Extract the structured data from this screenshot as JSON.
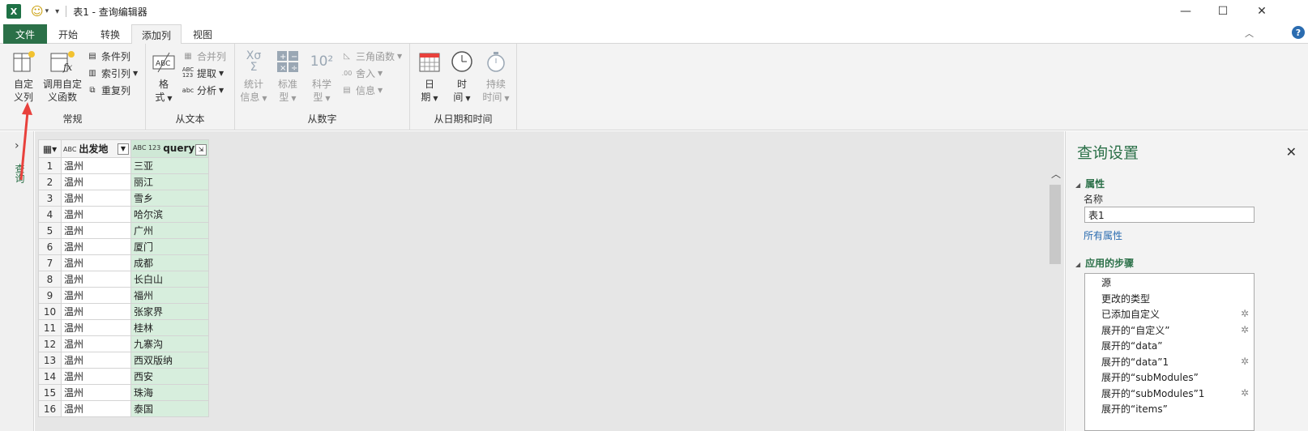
{
  "titlebar": {
    "app_icon": "X",
    "quick_access": [
      "smiley-icon",
      "dropdown-icon",
      "customize-icon"
    ],
    "title": "表1 - 查询编辑器",
    "minimize": "—",
    "maximize": "☐",
    "close": "✕"
  },
  "tabs": [
    {
      "label": "文件"
    },
    {
      "label": "开始"
    },
    {
      "label": "转换"
    },
    {
      "label": "添加列"
    },
    {
      "label": "视图"
    }
  ],
  "tabs_right": {
    "collapse": "︿",
    "help": "?"
  },
  "ribbon": {
    "groups": [
      {
        "label": "常规",
        "big_buttons": [
          {
            "line1": "自定",
            "line2": "义列"
          },
          {
            "line1": "调用自定",
            "line2": "义函数"
          }
        ],
        "small_buttons": [
          {
            "label": "条件列"
          },
          {
            "label": "索引列"
          },
          {
            "label": "重复列"
          }
        ]
      },
      {
        "label": "从文本",
        "big_buttons": [
          {
            "line1": "格",
            "line2": "式"
          }
        ],
        "small_buttons": [
          {
            "label": "合并列"
          },
          {
            "label": "提取"
          },
          {
            "label": "分析"
          }
        ]
      },
      {
        "label": "从数字",
        "big_buttons": [
          {
            "line1": "统计",
            "line2": "信息"
          },
          {
            "line1": "标准",
            "line2": "型"
          },
          {
            "line1": "科学",
            "line2": "型"
          }
        ],
        "small_buttons": [
          {
            "label": "三角函数"
          },
          {
            "label": "舍入"
          },
          {
            "label": "信息"
          }
        ]
      },
      {
        "label": "从日期和时间",
        "big_buttons": [
          {
            "line1": "日",
            "line2": "期"
          },
          {
            "line1": "时",
            "line2": "间"
          },
          {
            "line1": "持续",
            "line2": "时间"
          }
        ]
      }
    ]
  },
  "navpane": {
    "label": "查询"
  },
  "grid": {
    "columns": [
      {
        "type": "ABC",
        "name": "出发地"
      },
      {
        "type": "ABC 123",
        "name": "query"
      }
    ],
    "rows": [
      [
        "1",
        "温州",
        "三亚"
      ],
      [
        "2",
        "温州",
        "丽江"
      ],
      [
        "3",
        "温州",
        "雪乡"
      ],
      [
        "4",
        "温州",
        "哈尔滨"
      ],
      [
        "5",
        "温州",
        "广州"
      ],
      [
        "6",
        "温州",
        "厦门"
      ],
      [
        "7",
        "温州",
        "成都"
      ],
      [
        "8",
        "温州",
        "长白山"
      ],
      [
        "9",
        "温州",
        "福州"
      ],
      [
        "10",
        "温州",
        "张家界"
      ],
      [
        "11",
        "温州",
        "桂林"
      ],
      [
        "12",
        "温州",
        "九寨沟"
      ],
      [
        "13",
        "温州",
        "西双版纳"
      ],
      [
        "14",
        "温州",
        "西安"
      ],
      [
        "15",
        "温州",
        "珠海"
      ],
      [
        "16",
        "温州",
        "泰国"
      ]
    ]
  },
  "settings": {
    "title": "查询设置",
    "properties_header": "属性",
    "name_label": "名称",
    "name_value": "表1",
    "all_properties": "所有属性",
    "steps_header": "应用的步骤",
    "steps": [
      {
        "label": "源",
        "gear": false
      },
      {
        "label": "更改的类型",
        "gear": false
      },
      {
        "label": "已添加自定义",
        "gear": true
      },
      {
        "label": "展开的“自定义”",
        "gear": true
      },
      {
        "label": "展开的“data”",
        "gear": false
      },
      {
        "label": "展开的“data”1",
        "gear": true
      },
      {
        "label": "展开的“subModules”",
        "gear": false
      },
      {
        "label": "展开的“subModules”1",
        "gear": true
      },
      {
        "label": "展开的“items”",
        "gear": false
      }
    ]
  },
  "colors": {
    "accent": "#2b7048",
    "query_column": "#d7eedd",
    "arrow": "#e8413c"
  }
}
